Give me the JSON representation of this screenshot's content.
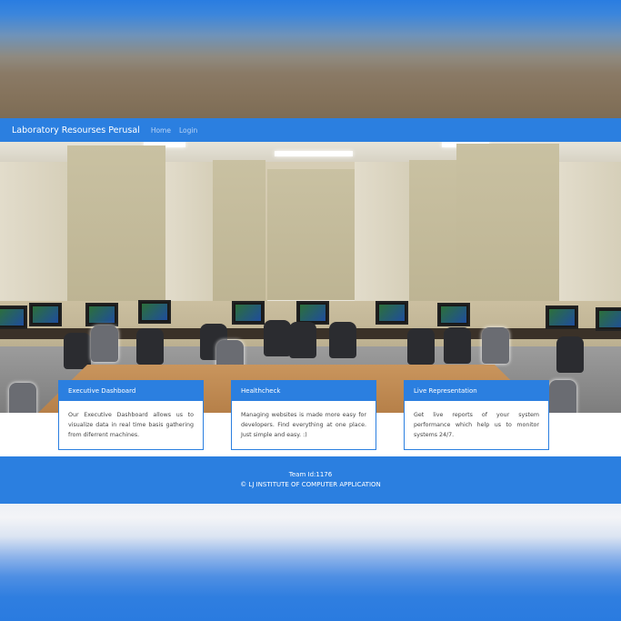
{
  "navbar": {
    "brand": "Laboratory Resourses Perusal",
    "links": [
      "Home",
      "Login"
    ]
  },
  "hero": {
    "image": "computer-lab-photo"
  },
  "cards": [
    {
      "title": "Executive Dashboard",
      "text": "Our Executive Dashboard allows us to visualize data in real time basis gathering from diferrent machines."
    },
    {
      "title": "Healthcheck",
      "text": "Managing websites is made more easy for developers. Find everything at one place. Just simple and easy. :)"
    },
    {
      "title": "Live Representation",
      "text": "Get live reports of your system performance which help us to monitor systems 24/7."
    }
  ],
  "footer": {
    "team": "Team Id:1176",
    "copyright": "© LJ INSTITUTE OF COMPUTER APPLICATION"
  },
  "colors": {
    "primary": "#2b7fe0",
    "background": "#ffffff"
  }
}
